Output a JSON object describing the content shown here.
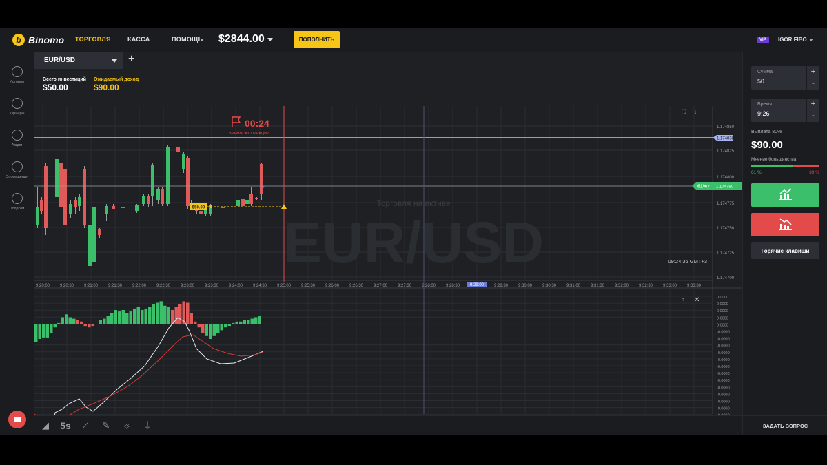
{
  "header": {
    "logo_text": "Binomo",
    "nav": [
      {
        "label": "ТОРГОВЛЯ",
        "active": true
      },
      {
        "label": "КАССА",
        "active": false
      },
      {
        "label": "ПОМОЩЬ",
        "active": false
      }
    ],
    "balance": "$2844.00",
    "deposit_label": "ПОПОЛНИТЬ",
    "vip_badge": "VIP",
    "user_name": "IGOR FIBO"
  },
  "sidebar": {
    "items": [
      {
        "label": "История",
        "icon": "history-icon"
      },
      {
        "label": "Турниры",
        "icon": "trophy-icon"
      },
      {
        "label": "Акции",
        "icon": "percent-icon"
      },
      {
        "label": "Оповещения",
        "icon": "bell-icon"
      },
      {
        "label": "Подарки",
        "icon": "gift-icon"
      }
    ]
  },
  "tab": {
    "asset": "EUR/USD",
    "add_label": "+"
  },
  "summary": {
    "invest_label": "Всего инвестиций",
    "invest_value": "$50.00",
    "expected_label": "Ожидаемый доход",
    "expected_value": "$90.00"
  },
  "chart": {
    "timer": "00:24",
    "timer_caption": "ВРЕМЯ ЭКСПИРАЦИИ",
    "watermark_small": "Торговля на активе",
    "watermark_big": "EUR/USD",
    "clock": "09:24:36 GMT+3",
    "bet_label": "$50.00",
    "price_badge_pct": "61%",
    "price_badge_arrow": "↑",
    "price_badge_value": "1.174790",
    "expiry_marker": "9:29:00",
    "price_axis": [
      "1.174850",
      "1.174838",
      "1.174825",
      "1.174800",
      "1.174790",
      "1.174775",
      "1.174750",
      "1.174725",
      "1.174700"
    ],
    "time_axis": [
      "9:20:00",
      "9:20:30",
      "9:21:00",
      "9:21:30",
      "9:22:00",
      "9:22:30",
      "9:23:00",
      "9:23:30",
      "9:24:00",
      "9:24:30",
      "9:25:00",
      "9:25:30",
      "9:26:00",
      "9:26:30",
      "9:27:00",
      "9:27:30",
      "9:28:00",
      "9:28:30",
      "9:29:00",
      "9:29:30",
      "9:30:00",
      "9:30:30",
      "9:31:00",
      "9:31:30",
      "9:32:00",
      "9:32:30",
      "9:33:00",
      "9:33:30"
    ],
    "indicator_axis": [
      "0.0000",
      "0.0000",
      "0.0000",
      "0.0000",
      "0.0000",
      "-0.0000",
      "-0.0000",
      "-0.0000",
      "-0.0000",
      "-0.0000",
      "-0.0000",
      "-0.0000",
      "-0.0000",
      "-0.0000",
      "-0.0000",
      "-0.0000",
      "-0.0000",
      "-0.0000"
    ],
    "colors": {
      "up": "#3cbf6a",
      "down": "#e05a5a",
      "expiry": "#e34b4b",
      "current": "#6a7bd8",
      "bet": "#f5c518"
    }
  },
  "trade": {
    "amount_label": "Сумма",
    "amount_value": "50",
    "time_label": "Время",
    "time_value": "9:26",
    "payout_label": "Выплата 80%",
    "payout_value": "$90.00",
    "opinion_label": "Мнение большинства",
    "opinion_up_pct": "61 %",
    "opinion_down_pct": "39 %",
    "opinion_up_fraction": 0.61,
    "hotkeys_label": "Горячие клавиши",
    "ask_label": "ЗАДАТЬ ВОПРОС"
  },
  "toolbar": {
    "items": [
      "chart-type-icon",
      "5s",
      "indicators-icon",
      "drawings-icon",
      "theme-icon",
      "plugins-icon"
    ]
  }
}
